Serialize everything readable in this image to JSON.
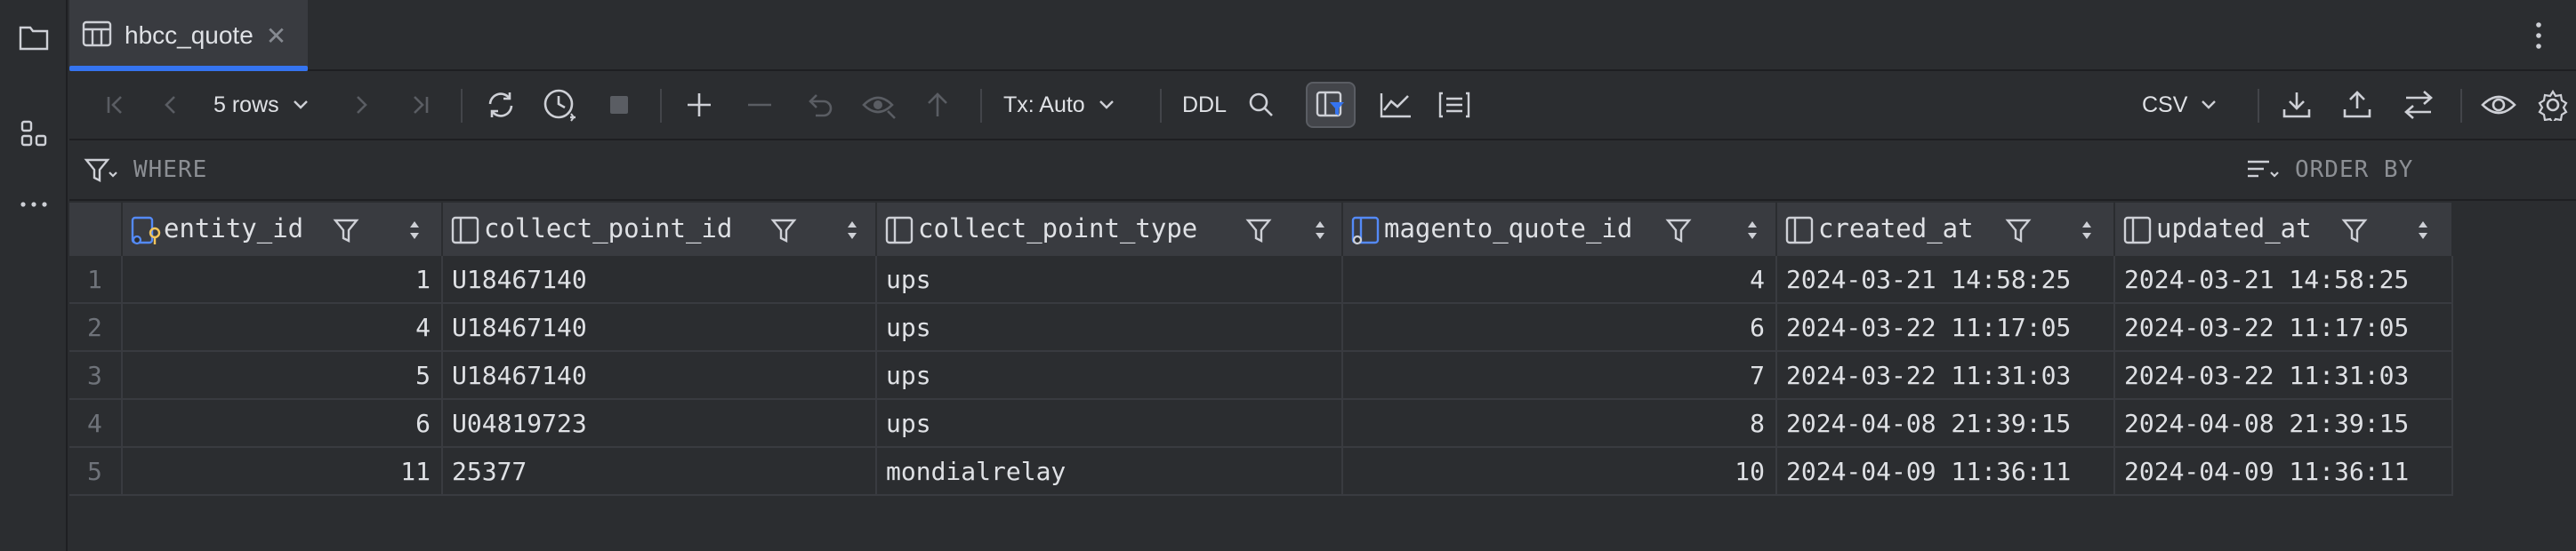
{
  "tab": {
    "title": "hbcc_quote",
    "close": "✕"
  },
  "toolbar": {
    "rows_label": "5 rows",
    "tx_label": "Tx: Auto",
    "ddl_label": "DDL",
    "export_format": "CSV"
  },
  "filters": {
    "where_placeholder": "WHERE",
    "order_by_placeholder": "ORDER BY"
  },
  "table": {
    "columns": [
      {
        "name": "entity_id",
        "icon": "key-column-icon"
      },
      {
        "name": "collect_point_id",
        "icon": "column-icon"
      },
      {
        "name": "collect_point_type",
        "icon": "column-icon"
      },
      {
        "name": "magento_quote_id",
        "icon": "index-column-icon"
      },
      {
        "name": "created_at",
        "icon": "column-icon"
      },
      {
        "name": "updated_at",
        "icon": "column-icon"
      }
    ],
    "rows": [
      {
        "n": "1",
        "cells": [
          "1",
          "U18467140",
          "ups",
          "4",
          "2024-03-21 14:58:25",
          "2024-03-21 14:58:25"
        ]
      },
      {
        "n": "2",
        "cells": [
          "4",
          "U18467140",
          "ups",
          "6",
          "2024-03-22 11:17:05",
          "2024-03-22 11:17:05"
        ]
      },
      {
        "n": "3",
        "cells": [
          "5",
          "U18467140",
          "ups",
          "7",
          "2024-03-22 11:31:03",
          "2024-03-22 11:31:03"
        ]
      },
      {
        "n": "4",
        "cells": [
          "6",
          "U04819723",
          "ups",
          "8",
          "2024-04-08 21:39:15",
          "2024-04-08 21:39:15"
        ]
      },
      {
        "n": "5",
        "cells": [
          "11",
          "25377",
          "mondialrelay",
          "10",
          "2024-04-09 11:36:11",
          "2024-04-09 11:36:11"
        ]
      }
    ]
  },
  "colors": {
    "accent": "#3574f0",
    "background": "#2b2d30",
    "header": "#393b40"
  }
}
